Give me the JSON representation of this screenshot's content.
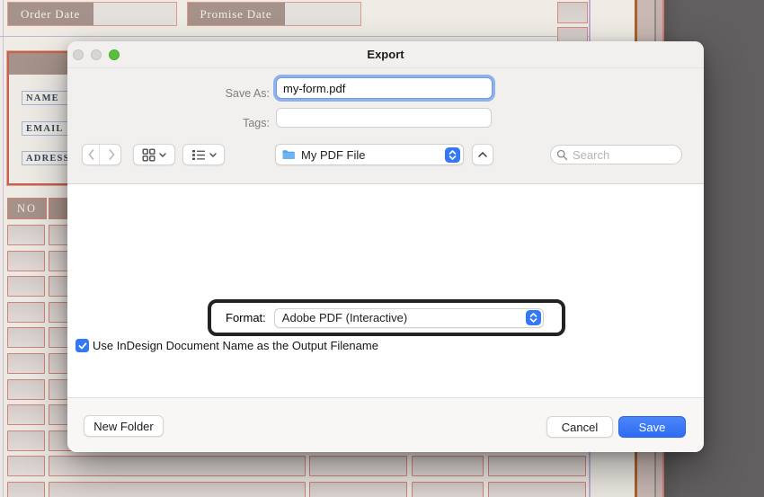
{
  "window": {
    "title": "Export",
    "traffic_lights": [
      "close-inactive",
      "minimize-inactive",
      "zoom-active"
    ]
  },
  "fields": {
    "save_as_label": "Save As:",
    "save_as_value": "my-form.pdf",
    "tags_label": "Tags:",
    "tags_value": ""
  },
  "toolbar": {
    "folder_name": "My PDF File",
    "search_placeholder": "Search"
  },
  "format_row": {
    "label": "Format:",
    "value": "Adobe PDF (Interactive)"
  },
  "options": {
    "use_name_checkbox_label": "Use InDesign Document Name as the Output Filename",
    "checked": true
  },
  "footer": {
    "new_folder": "New Folder",
    "cancel": "Cancel",
    "save": "Save"
  },
  "document": {
    "order_date": "Order Date",
    "promise_date": "Promise Date",
    "name": "NAME",
    "email": "EMAIL",
    "address": "ADRESS",
    "no": "NO",
    "table": {
      "rows": 11
    }
  },
  "colors": {
    "accent": "#3478f6",
    "focus-ring": "#8fb2ec",
    "taupe": "#a59289",
    "pink-border": "#d98b82",
    "red-frame": "#c4614f",
    "cell-fill": "#d9d1ce",
    "paper": "#edeae4",
    "desk": "#5e5c5c",
    "guide": "#b49bd1",
    "green-light": "#57c13e"
  }
}
